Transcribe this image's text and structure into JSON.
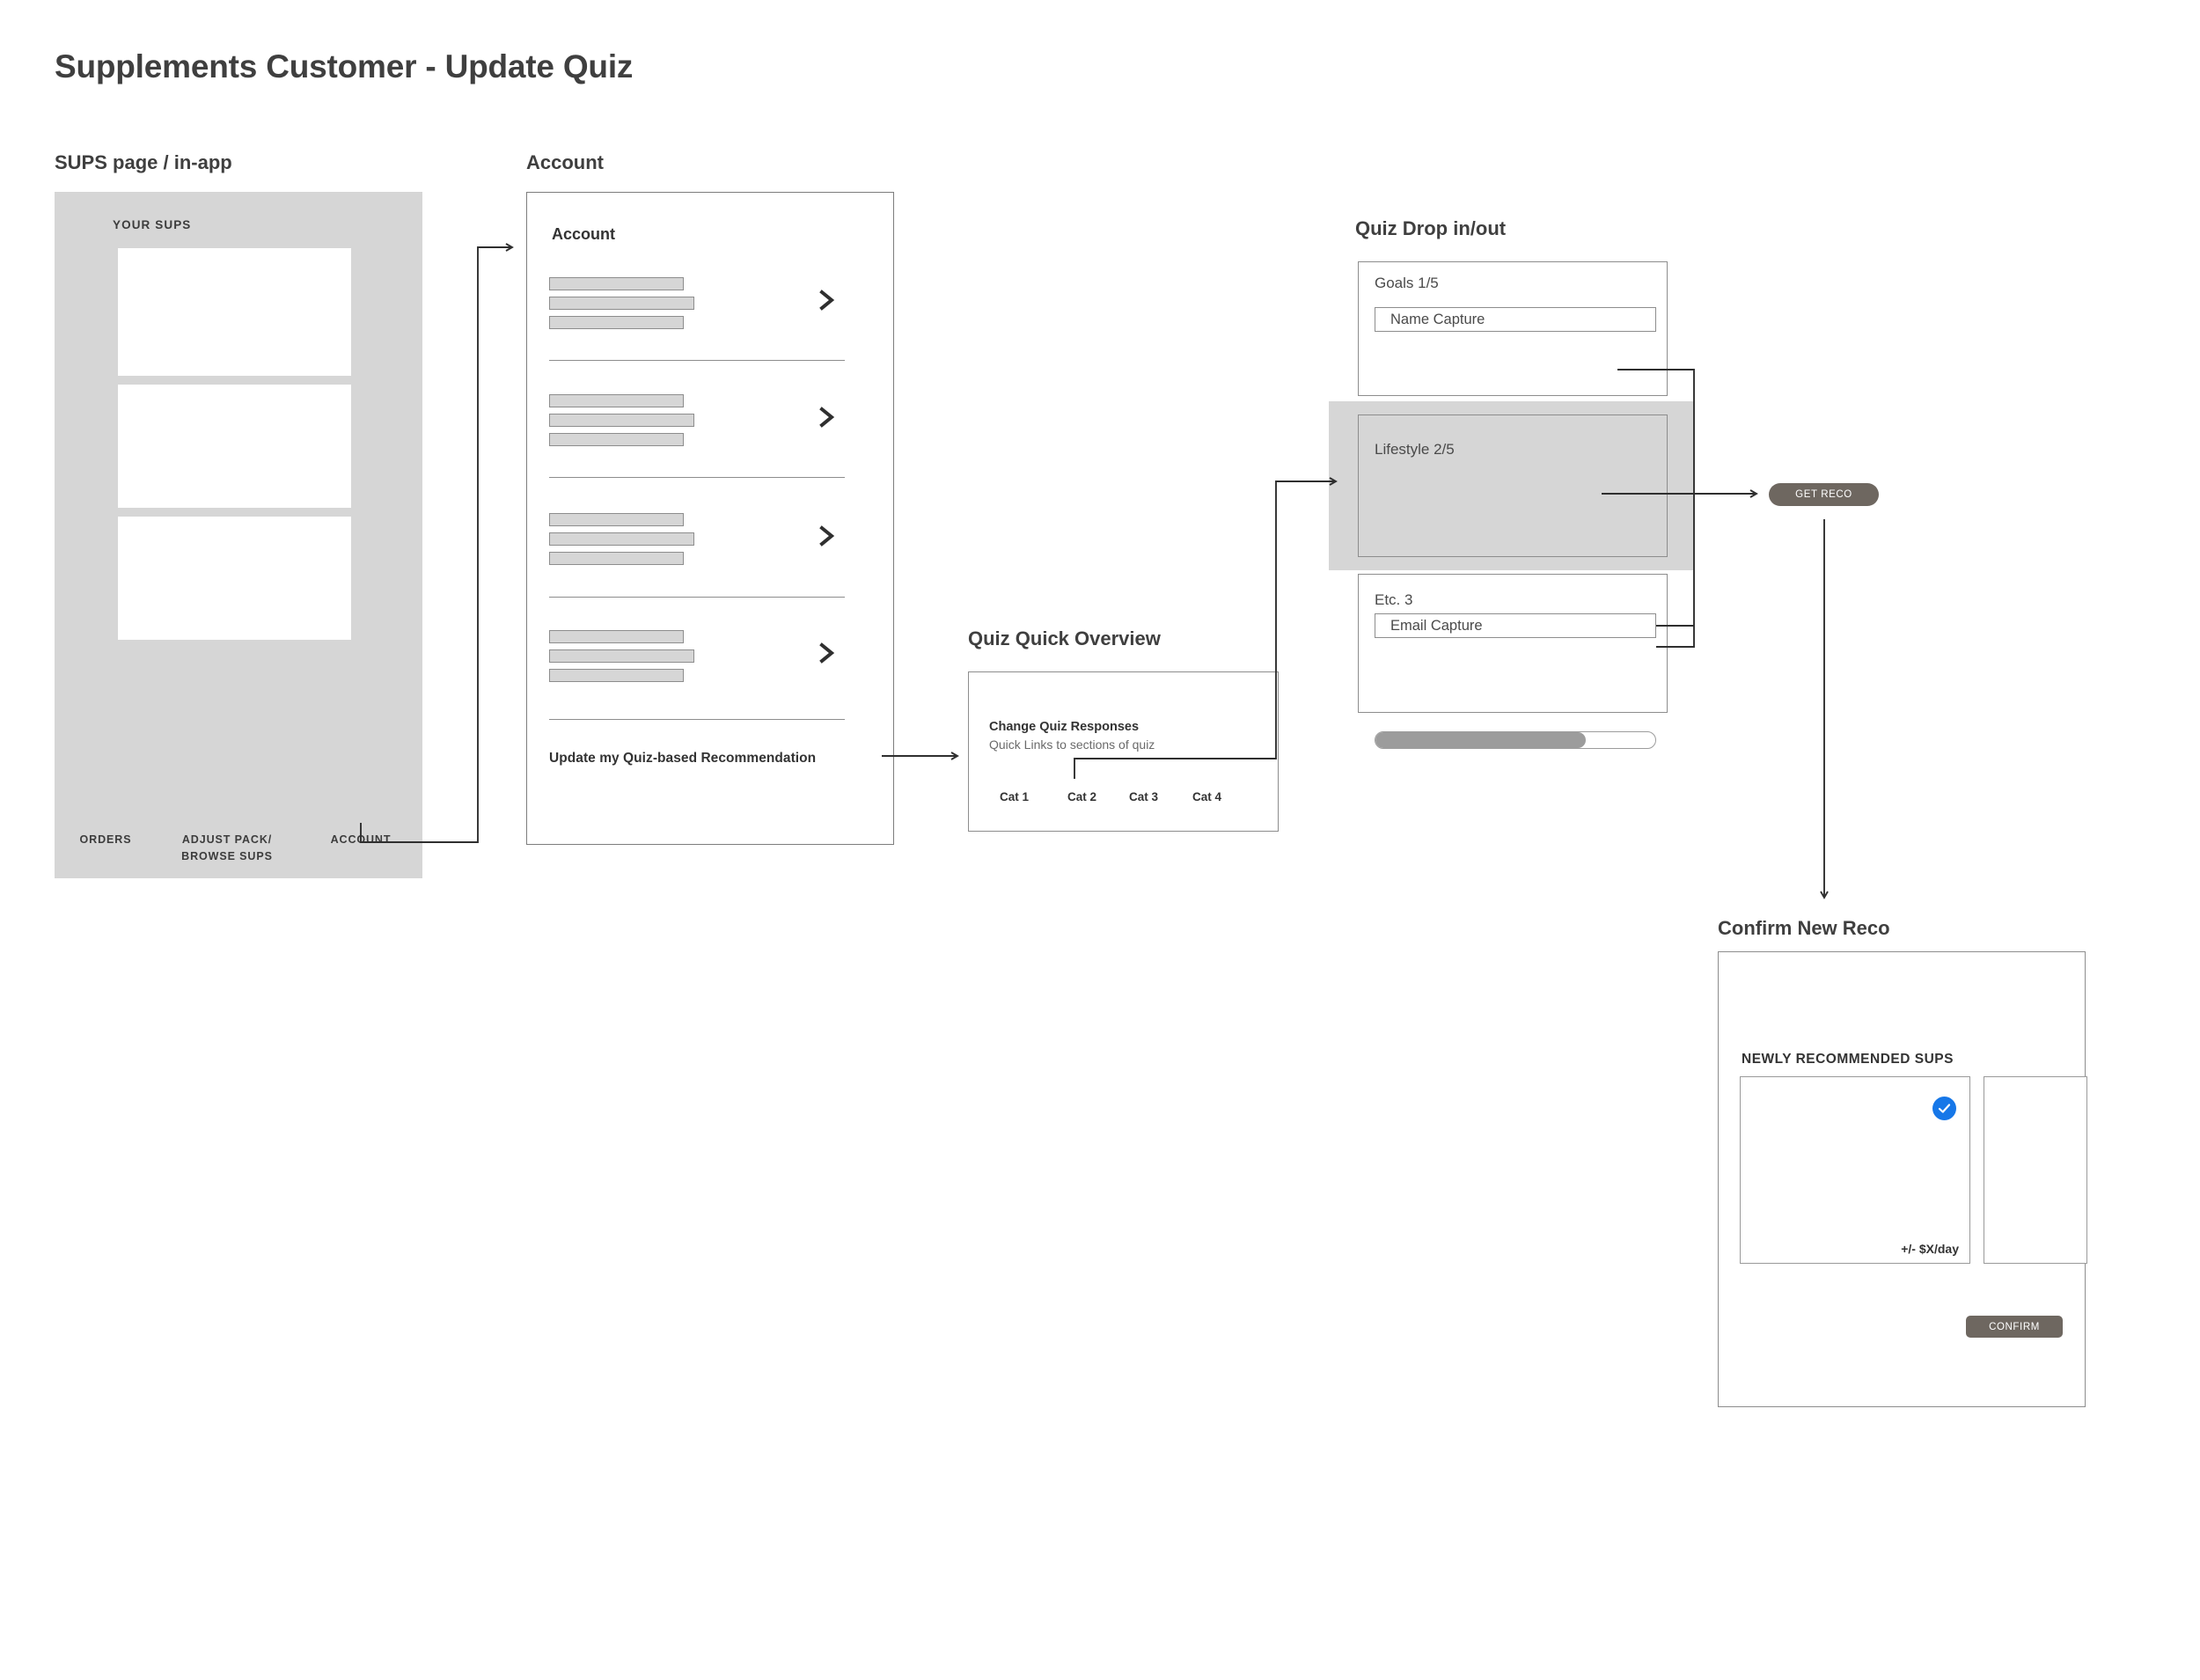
{
  "page": {
    "title": "Supplements Customer - Update Quiz"
  },
  "sections": {
    "sups": {
      "title": "SUPS page / in-app"
    },
    "account": {
      "title": "Account"
    },
    "quiz_drop": {
      "title": "Quiz Drop in/out"
    },
    "quiz_quick_overview": {
      "title": "Quiz Quick Overview"
    },
    "confirm": {
      "title": "Confirm New Reco"
    }
  },
  "sups_page": {
    "heading": "YOUR SUPS",
    "cards": [
      "",
      "",
      ""
    ],
    "nav": [
      {
        "label": "ORDERS"
      },
      {
        "label": "ADJUST PACK/\nBROWSE SUPS"
      },
      {
        "label": "ACCOUNT"
      }
    ],
    "nav_orders": "ORDERS",
    "nav_adjust_line1": "ADJUST PACK/",
    "nav_adjust_line2": "BROWSE SUPS",
    "nav_account": "ACCOUNT"
  },
  "account_panel": {
    "label": "Account",
    "rows": [
      {
        "chevron": "chevron-right-icon"
      },
      {
        "chevron": "chevron-right-icon"
      },
      {
        "chevron": "chevron-right-icon"
      },
      {
        "chevron": "chevron-right-icon"
      }
    ],
    "update_link": "Update my Quiz-based Recommendation"
  },
  "quiz_quick_overview": {
    "heading": "Change Quiz Responses",
    "subheading": "Quick Links to sections of quiz",
    "categories": [
      "Cat 1",
      "Cat 2",
      "Cat 3",
      "Cat 4"
    ]
  },
  "quiz_drop": {
    "steps": [
      {
        "label": "Goals 1/5",
        "input_value": "Name Capture",
        "highlighted": false
      },
      {
        "label": "Lifestyle 2/5",
        "input_value": "",
        "highlighted": true
      },
      {
        "label": "Etc. 3",
        "input_value": "Email Capture",
        "highlighted": false
      }
    ],
    "goals_label": "Goals 1/5",
    "goals_input": "Name Capture",
    "lifestyle_label": "Lifestyle 2/5",
    "etc_label": "Etc. 3",
    "etc_input": "Email Capture",
    "progress_percent": 75
  },
  "get_reco_button": {
    "label": "GET RECO"
  },
  "confirm_panel": {
    "heading": "NEWLY RECOMMENDED SUPS",
    "card_price": "+/- $X/day",
    "selected_icon": "check-circle-icon",
    "confirm_button": "CONFIRM"
  },
  "colors": {
    "panel_fill": "#d6d6d6",
    "stroke": "#8d8d8d",
    "text": "#3c3c3c",
    "button": "#6e6760",
    "accent_check": "#1677e8"
  }
}
